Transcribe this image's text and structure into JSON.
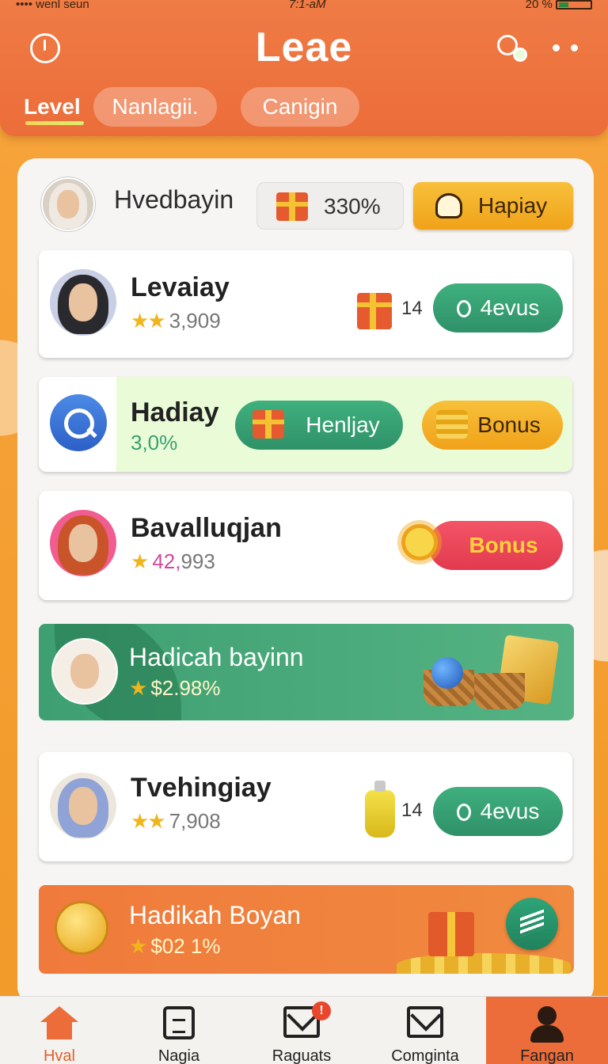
{
  "status_bar": {
    "carrier": "•••• wenl seun",
    "time": "7:1-aM",
    "battery": "20 %"
  },
  "header": {
    "title": "Leae",
    "tabs": [
      {
        "label": "Level",
        "active": true
      },
      {
        "label": "Nanlagii."
      },
      {
        "label": "Canigin"
      }
    ]
  },
  "user": {
    "name": "Hvedbayin",
    "percent": "330%",
    "action_label": "Hapiay"
  },
  "cards": [
    {
      "name": "Levaiay",
      "stars": "★★",
      "value": "3,909",
      "count": "14",
      "button": "4evus"
    },
    {
      "name": "Hadiay",
      "value": "3,0%",
      "button_gift": "Henljay",
      "button_bonus": "Bonus"
    },
    {
      "name": "Bavalluqjan",
      "stars": "★",
      "value_a": "42,",
      "value_b": "993",
      "button": "Bonus"
    },
    {
      "name": "Tvehingiay",
      "stars": "★★",
      "value": "7,908",
      "count": "14",
      "button": "4evus"
    }
  ],
  "banners": [
    {
      "name": "Hadicah bayinn",
      "stars": "★",
      "value": "$2.98%"
    },
    {
      "name": "Hadikah Boyan",
      "stars": "★",
      "value": "$02 1%"
    }
  ],
  "nav": [
    {
      "label": "Hval",
      "icon": "home-icon",
      "active": true
    },
    {
      "label": "Nagia",
      "icon": "clipboard-icon"
    },
    {
      "label": "Raguats",
      "icon": "mail-icon",
      "badge": "!"
    },
    {
      "label": "Comginta",
      "icon": "envelope-icon"
    },
    {
      "label": "Fangan",
      "icon": "user-icon"
    }
  ],
  "colors": {
    "accent": "#ec6d3a",
    "green": "#2f9168",
    "gold": "#f0a21a",
    "red": "#e23a4e"
  }
}
